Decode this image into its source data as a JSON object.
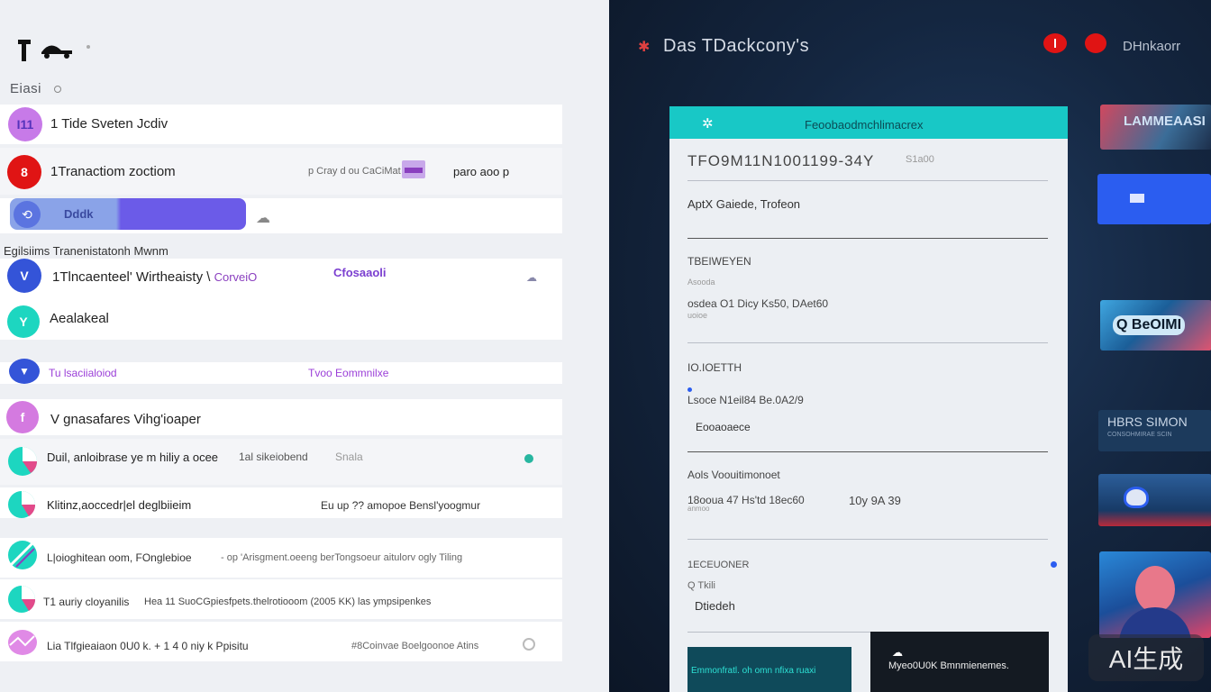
{
  "left": {
    "list_header": "Eiasi",
    "rows": [
      {
        "avatar": "I11",
        "title": "1 Tide Sveten Jcdiv"
      },
      {
        "avatar": "8",
        "title": "1Tranactiom zoctiom",
        "meta": "p Cray  d ou CaCiMat Lnce",
        "extra": "paro  aoo p"
      },
      {
        "label": "Dddk"
      },
      {
        "avatar": "V",
        "title": "1Tlncaenteel' Wirtheaisty \\",
        "accent": "CorveiO",
        "tag": "Cfosaaoli"
      },
      {
        "avatar": "Y",
        "title": "Aealakeal"
      },
      {
        "left_text": "Tu lsaciialoiod",
        "right_text": "Tvoo Eommnilxe"
      },
      {
        "avatar": "f",
        "title": "V gnasafares Vihg'ioaper"
      },
      {
        "title": "Duil, anloibrase ye m hiliy a ocee",
        "meta": "1al sikeiobend",
        "extra": "Snala"
      },
      {
        "title": "Klitinz,aoccedr|el deglbiieim",
        "meta": "Eu  up ?? amopoe Bensl'yoogmur"
      },
      {
        "title": "L|oioghitean oom, FOnglebioe",
        "meta": "- op 'Arisgment.oeeng berTongsoeur aitulorv ogly Tiling"
      },
      {
        "title": "T1 auriy cloyanilis",
        "meta": "Hea 11 SuoCGpiesfpets.thelrotiooom (2005 KK) las ympsipenkes"
      },
      {
        "title": "Lia Tlfgieaiaon 0U0 k. + 1 4 0 niy k Ppisitu",
        "meta": "#8Coinvae Boelgoonoe Atins"
      }
    ],
    "section_label": "Egilsiims  Tranenistatonh Mwnm"
  },
  "right": {
    "title": "Das TDackcony's",
    "user": "DHnkaorr",
    "card": {
      "header": "Feoobaodmchlimacrex",
      "id_line": "TFO9M11N1001199-34Y",
      "id_suffix": "S1a00",
      "fields": [
        {
          "value": "AptX Gaiede, Trofeon"
        },
        {
          "label": "TBEIWEYEN",
          "hint": "Asooda",
          "value": "osdea  O1 Dicy Ks50, DAet60",
          "sub": "uoioe"
        },
        {
          "label": "IO.IOETTH",
          "value": "Lsoce N1eil84 Be.0A2/9",
          "sub": "Eooaoaece"
        },
        {
          "label": "Aols Voouitimonoet",
          "value": "18ooua 47  Hs'td 18ec60",
          "value2": "10y 9A 39",
          "sub": "anmoo"
        },
        {
          "label": "1ECEUONER",
          "hint": "Q Tkili",
          "value": "Dtiedeh"
        }
      ],
      "tiles": [
        {
          "text": "Emmonfratl. oh omn nfixa ruaxi"
        },
        {
          "text": "Myeo0U0K Bmnmienemes."
        }
      ]
    },
    "thumbs": [
      {
        "text": "LAMMEAASI"
      },
      {
        "text": "Q BeOIMI"
      },
      {
        "text": "HBRS  SIMON",
        "sub": "CONSOHMIRAE SCIN"
      }
    ]
  },
  "watermark": "AI生成",
  "colors": {
    "accent_teal": "#18c8c6",
    "accent_purple": "#6b5be8",
    "accent_red": "#e01414",
    "accent_blue": "#2b5df0",
    "dark_bg": "#0f1b2d"
  }
}
